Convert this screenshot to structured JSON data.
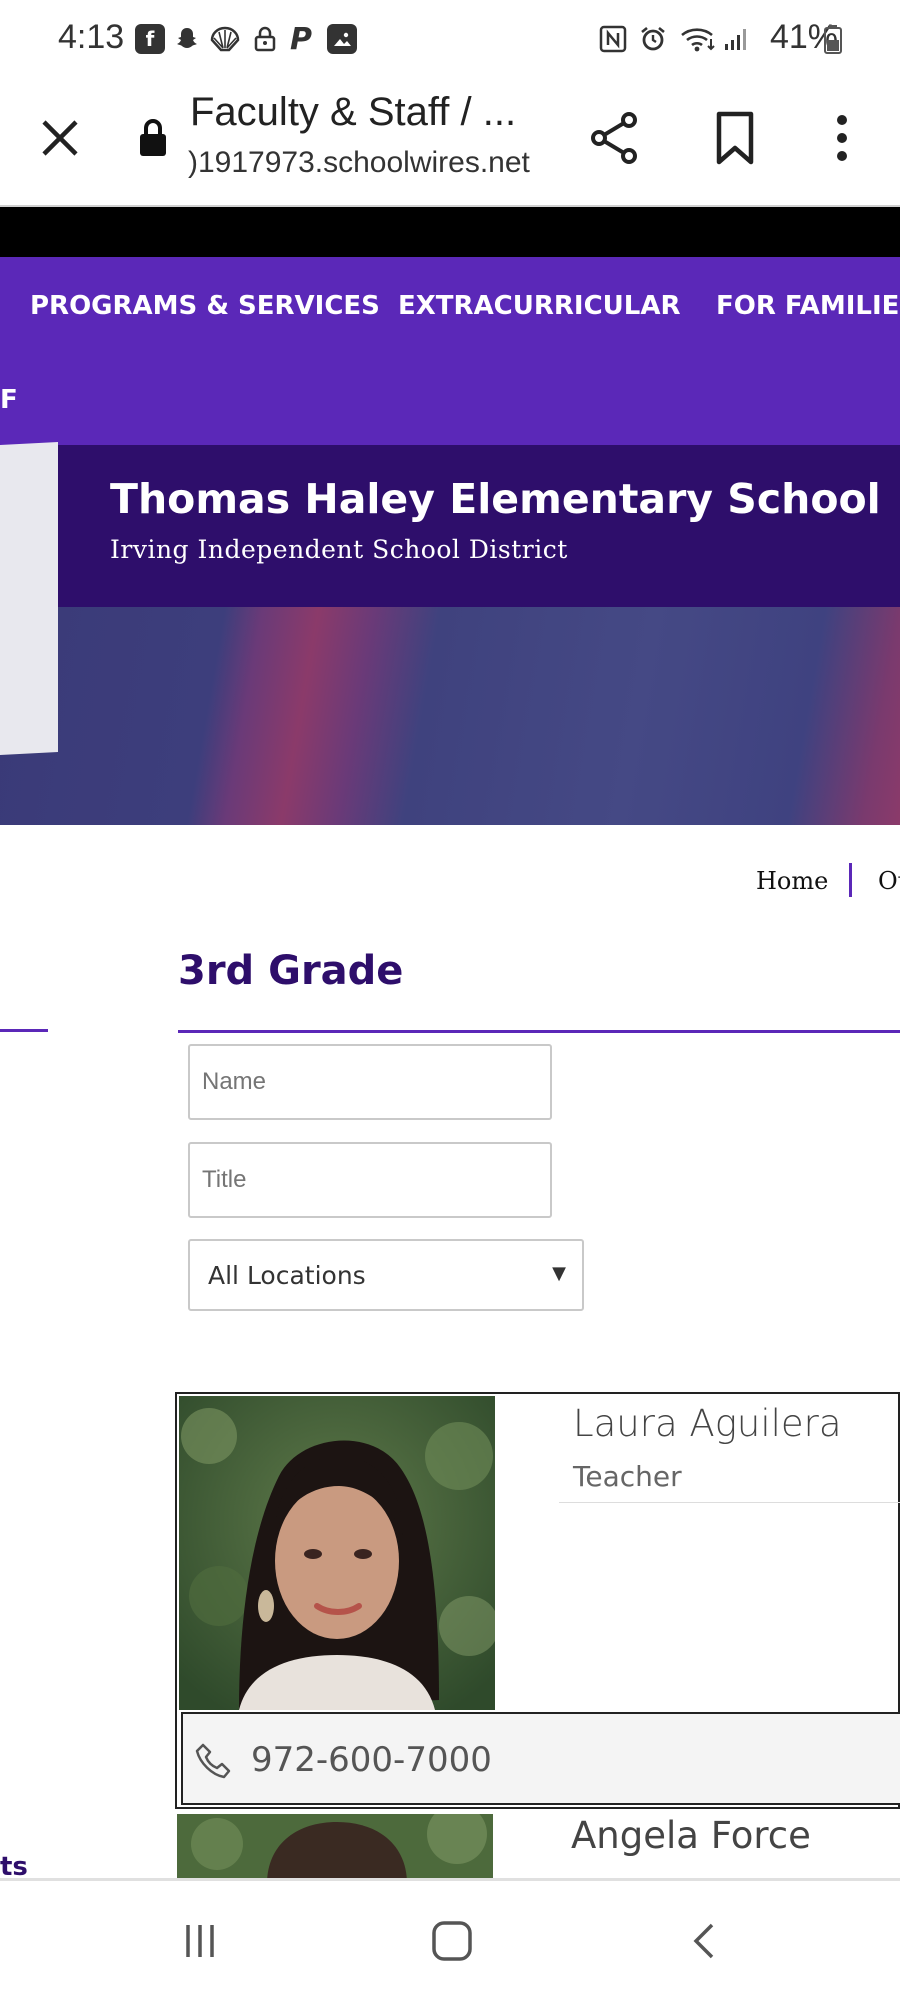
{
  "status_bar": {
    "time": "4:13",
    "battery": "41%",
    "icons_left": [
      "flipboard-icon",
      "snapchat-icon",
      "shell-icon",
      "lock-icon",
      "paypal-icon",
      "gallery-icon"
    ],
    "icons_right": [
      "nfc-icon",
      "alarm-icon",
      "wifi-icon",
      "signal-icon",
      "battery-icon"
    ]
  },
  "browser": {
    "title": "Faculty & Staff / ...",
    "url": ")1917973.schoolwires.net"
  },
  "nav": {
    "items": [
      "PROGRAMS & SERVICES",
      "EXTRACURRICULAR",
      "FOR FAMILIES"
    ],
    "overflow_fragment": "F"
  },
  "banner": {
    "school_name": "Thomas Haley Elementary School",
    "district_name": "Irving Independent School District"
  },
  "breadcrumb": {
    "home": "Home",
    "next": "Ou"
  },
  "section": {
    "title": "3rd Grade"
  },
  "filters": {
    "name_placeholder": "Name",
    "title_placeholder": "Title",
    "location_value": "All Locations"
  },
  "staff": [
    {
      "name": "Laura Aguilera",
      "role": "Teacher",
      "phone": "972-600-7000"
    },
    {
      "name": "Angela Force"
    }
  ],
  "sidebar": {
    "tail_text": "ts"
  },
  "colors": {
    "nav_purple": "#5b28b8",
    "banner_purple": "#2e0e6b",
    "heading_purple": "#2e0e6b"
  }
}
